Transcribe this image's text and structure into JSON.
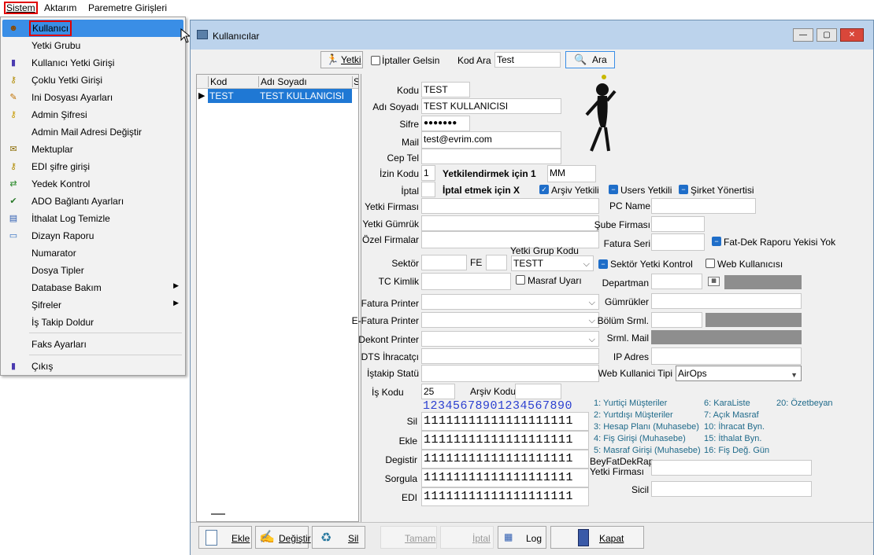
{
  "menubar": {
    "items": [
      "Sistem",
      "Aktarım",
      "Paremetre Girişleri"
    ]
  },
  "dropdown": {
    "items": [
      {
        "label": "Kullanıcı",
        "icon": "user-face-icon"
      },
      {
        "label": "Yetki Grubu",
        "icon": ""
      },
      {
        "label": "Kullanıcı Yetki Girişi",
        "icon": "user-key-icon"
      },
      {
        "label": "Çoklu Yetki Girişi",
        "icon": "multi-key-icon"
      },
      {
        "label": "Ini Dosyası Ayarları",
        "icon": "ini-file-icon"
      },
      {
        "label": "Admin Şifresi",
        "icon": "key-icon"
      },
      {
        "label": "Admin Mail Adresi Değiştir",
        "icon": ""
      },
      {
        "label": "Mektuplar",
        "icon": "letter-icon"
      },
      {
        "label": "EDI şifre girişi",
        "icon": "edi-key-icon"
      },
      {
        "label": "Yedek Kontrol",
        "icon": "backup-icon"
      },
      {
        "label": "ADO Bağlantı Ayarları",
        "icon": "connection-icon"
      },
      {
        "label": "İthalat Log Temizle",
        "icon": "log-clean-icon"
      },
      {
        "label": "Dizayn Raporu",
        "icon": "report-icon"
      },
      {
        "label": "Numarator",
        "icon": ""
      },
      {
        "label": "Dosya Tipler",
        "icon": ""
      },
      {
        "label": "Database Bakım",
        "icon": ""
      },
      {
        "label": "Şifreler",
        "icon": ""
      },
      {
        "label": "İş Takip Doldur",
        "icon": ""
      },
      {
        "label": "Faks Ayarları",
        "icon": ""
      },
      {
        "label": "Çıkış",
        "icon": "exit-icon"
      }
    ]
  },
  "window": {
    "title": "Kullanıcılar",
    "minimize": "—",
    "maximize": "▢",
    "close": "✕"
  },
  "toolbar": {
    "yetki": "Yetki",
    "iptaller": "İptaller Gelsin",
    "kod_ara_label": "Kod Ara",
    "kod_ara_value": "Test",
    "ara": "Ara"
  },
  "grid": {
    "col_kod": "Kod",
    "col_adi": "Adı Soyadı",
    "col_s": "S",
    "row_kod": "TEST",
    "row_adi": "TEST KULLANICISI",
    "row_ptr": "▶"
  },
  "form": {
    "kodu_label": "Kodu",
    "kodu": "TEST",
    "adi_label": "Adı Soyadı",
    "adi": "TEST KULLANICISI",
    "sifre_label": "Sifre",
    "sifre": "●●●●●●●",
    "mail_label": "Mail",
    "mail": "test@evrim.com",
    "cep_label": "Cep Tel",
    "cep": "",
    "izin_label": "İzin Kodu",
    "izin": "1",
    "yetkilendir": "Yetkilendirmek için 1",
    "mm": "MM",
    "iptal_label": "İptal",
    "iptal": "",
    "iptal_x": "İptal etmek için X",
    "arsiv": "Arşiv Yetkili",
    "users": "Users Yetkili",
    "sirket": "Şirket Yönertisi",
    "yetki_firmasi": "Yetki Firması",
    "yetki_gumruk": "Yetki Gümrük",
    "ozel_firmalar": "Özel Firmalar",
    "pc_name": "PC Name",
    "sube": "Şube Firması",
    "fatura_seri": "Fatura Seri",
    "fatdek": "Fat-Dek Raporu Yekisi Yok",
    "sektor": "Sektör",
    "fe": "FE",
    "yetki_grup": "Yetki Grup Kodu",
    "yetki_grup_val": "TESTT",
    "sektor_yetki": "Sektör Yetki Kontrol",
    "web_kul": "Web Kullanıcısı",
    "tc": "TC Kimlik",
    "masraf": "Masraf Uyarı",
    "departman": "Departman",
    "fatura_printer": "Fatura Printer",
    "gumrukler": "Gümrükler",
    "efatura": "E-Fatura Printer",
    "bolum": "Bölüm Srml.",
    "dekont": "Dekont Printer",
    "srml_mail": "Srml. Mail",
    "dts": "DTS İhracatçı",
    "ip": "IP Adres",
    "istakip": "İştakip Statü",
    "web_tipi": "Web Kullanici Tipi",
    "web_tipi_val": "AirOps",
    "is_kodu": "İş Kodu",
    "is_kodu_val": "25",
    "arsiv_kodu": "Arşiv Kodu",
    "digits": "12345678901234567890",
    "sil_label": "Sil",
    "sil": "11111111111111111111",
    "ekle_label": "Ekle",
    "ekle": "11111111111111111111",
    "degistir_label": "Degistir",
    "degistir": "11111111111111111111",
    "sorgula_label": "Sorgula",
    "sorgula": "11111111111111111111",
    "edi_label": "EDI",
    "edi": "11111111111111111111",
    "bey_label": "BeyFatDekRap Yetki Firması",
    "sicil": "Sicil"
  },
  "legend": {
    "col1": [
      "1: Yurtiçi Müşteriler",
      "2: Yurtdışı Müşteriler",
      "3: Hesap Planı (Muhasebe)",
      "4: Fiş Girişi (Muhasebe)",
      "5: Masraf Girişi (Muhasebe)"
    ],
    "col2": [
      "6: KaraListe",
      "7: Açık Masraf",
      "10: İhracat Byn.",
      "15: İthalat Byn.",
      "16: Fiş Değ. Gün"
    ],
    "col3": [
      "20: Özetbeyan"
    ]
  },
  "bottom": {
    "ekle": "Ekle",
    "degistir": "Değiştir",
    "sil": "Sil",
    "tamam": "Tamam",
    "iptal": "İptal",
    "log": "Log",
    "kapat": "Kapat"
  },
  "colors": {
    "accent": "#1f6ec9",
    "highlight": "#3a8ee6",
    "redbox": "#e00000",
    "titlebar": "#bcd3ec"
  }
}
